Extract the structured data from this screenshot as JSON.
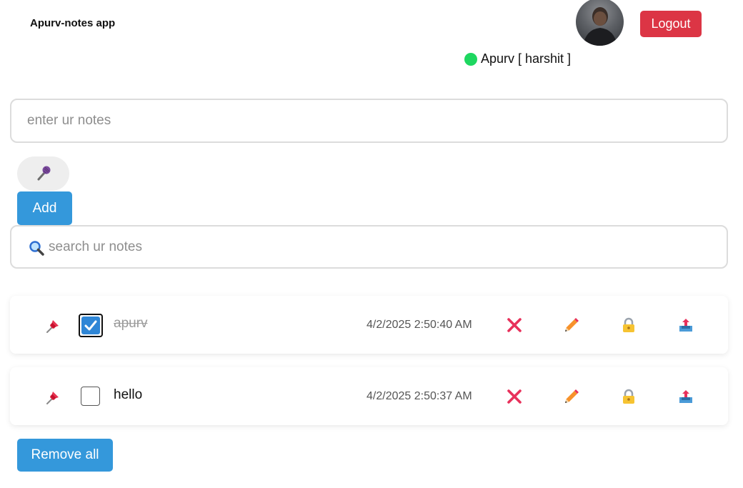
{
  "header": {
    "app_title": "Apurv-notes app",
    "logout_label": "Logout",
    "status_text": "Apurv [ harshit ]",
    "status_color": "#1ed760"
  },
  "composer": {
    "placeholder": "enter ur notes",
    "mic_icon": "microphone-icon",
    "add_label": "Add"
  },
  "search": {
    "placeholder": "search ur notes",
    "icon": "magnifier-icon"
  },
  "notes": [
    {
      "text": "apurv",
      "timestamp": "4/2/2025 2:50:40 AM",
      "completed": true
    },
    {
      "text": "hello",
      "timestamp": "4/2/2025 2:50:37 AM",
      "completed": false
    }
  ],
  "note_actions": [
    "delete-icon",
    "edit-pencil-icon",
    "lock-icon",
    "share-icon"
  ],
  "footer": {
    "remove_all_label": "Remove all"
  },
  "colors": {
    "primary": "#3498db",
    "danger": "#dc3545",
    "delete_mark": "#e8315b"
  }
}
